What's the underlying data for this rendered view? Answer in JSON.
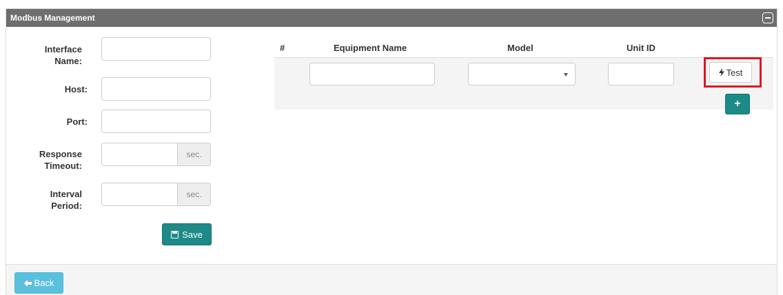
{
  "panel": {
    "title": "Modbus Management",
    "collapse_icon": "minus-square-icon"
  },
  "form": {
    "interface_name": {
      "label": "Interface Name:",
      "value": ""
    },
    "host": {
      "label": "Host:",
      "value": ""
    },
    "port": {
      "label": "Port:",
      "value": ""
    },
    "response_timeout": {
      "label": "Response Timeout:",
      "value": "",
      "unit": "sec."
    },
    "interval_period": {
      "label": "Interval Period:",
      "value": "",
      "unit": "sec."
    },
    "save_label": "Save",
    "save_icon": "floppy-disk-icon"
  },
  "equipment_table": {
    "columns": [
      "#",
      "Equipment Name",
      "Model",
      "Unit ID"
    ],
    "rows": [
      {
        "number": "",
        "equipment_name": "",
        "model": "",
        "unit_id": ""
      }
    ],
    "test_label": "Test",
    "test_icon": "lightning-bolt-icon",
    "add_label": "+"
  },
  "footer": {
    "back_label": "Back",
    "back_icon": "arrow-left-icon"
  },
  "colors": {
    "header_bg": "#6e6e6e",
    "primary_teal": "#1d8a87",
    "info_blue": "#5bc0de",
    "highlight_red": "#e2141b"
  }
}
